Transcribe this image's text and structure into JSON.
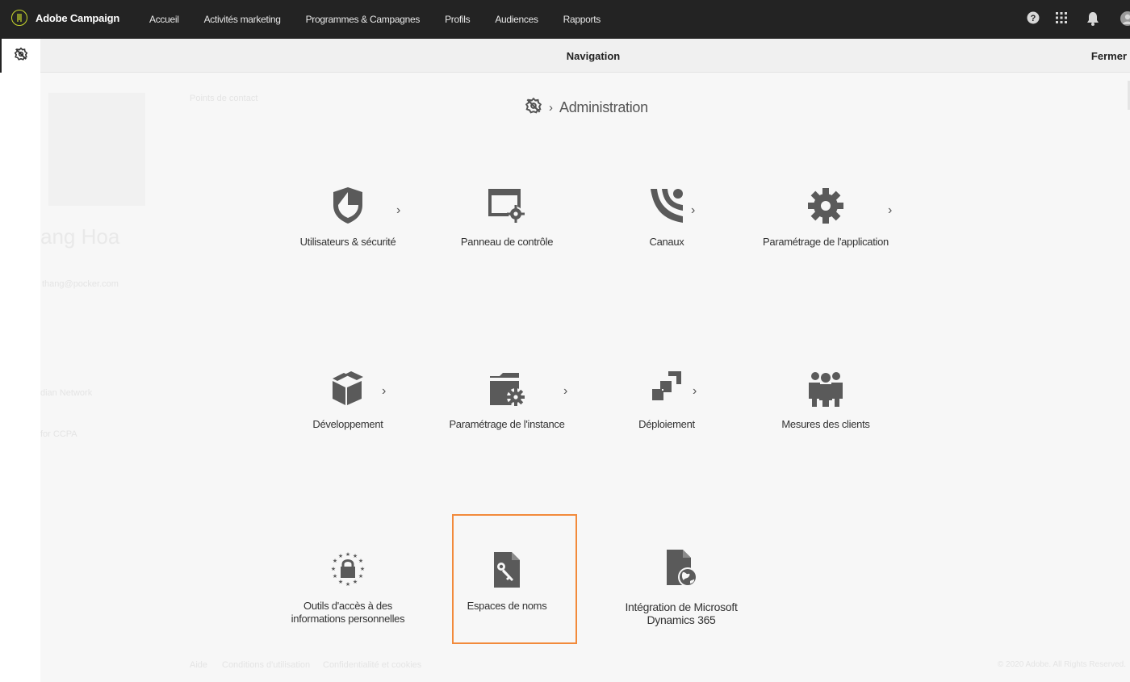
{
  "app": {
    "brand": "Adobe Campaign",
    "colors": {
      "topbar": "#232323",
      "brand_accent": "#c9d82b",
      "highlight": "#f28a3b",
      "icon": "#5a5a5a"
    }
  },
  "topnav": {
    "items": [
      "Accueil",
      "Activités marketing",
      "Programmes & Campagnes",
      "Profils",
      "Audiences",
      "Rapports"
    ],
    "icons": [
      "help-icon",
      "apps-grid-icon",
      "bell-icon",
      "avatar"
    ]
  },
  "navigation": {
    "title": "Navigation",
    "close_label": "Fermer"
  },
  "breadcrumb": {
    "root_icon": "admin-icon",
    "current": "Administration"
  },
  "tiles": [
    {
      "label": "Utilisateurs & sécurité",
      "icon": "shield-icon",
      "has_submenu": true
    },
    {
      "label": "Panneau de contrôle",
      "icon": "control-panel-icon",
      "has_submenu": false
    },
    {
      "label": "Canaux",
      "icon": "channels-icon",
      "has_submenu": true
    },
    {
      "label": "Paramétrage de l'application",
      "icon": "gear-icon",
      "has_submenu": true
    },
    {
      "label": "Développement",
      "icon": "cube-icon",
      "has_submenu": true
    },
    {
      "label": "Paramétrage de l'instance",
      "icon": "instance-settings-icon",
      "has_submenu": true
    },
    {
      "label": "Déploiement",
      "icon": "deployment-icon",
      "has_submenu": true
    },
    {
      "label": "Mesures des clients",
      "icon": "customers-icon",
      "has_submenu": false
    },
    {
      "label": "Outils d'accès à des informations personnelles",
      "label_lines": [
        "Outils d'accès à des",
        "informations personnelles"
      ],
      "icon": "privacy-lock-icon",
      "has_submenu": false
    },
    {
      "label": "Espaces de noms",
      "icon": "namespace-key-icon",
      "has_submenu": false,
      "highlighted": true
    },
    {
      "label": "Intégration de Microsoft Dynamics 365",
      "label_lines": [
        "Intégration de Microsoft",
        "Dynamics 365"
      ],
      "icon": "dynamics-globe-icon",
      "has_submenu": false
    }
  ],
  "background_ghost": {
    "name_fragment": "ang Hoa",
    "contact_label": "Points de contact",
    "email_fragment": "thang@pocker.com",
    "side_item_1": "dian Network",
    "side_item_2": "for CCPA",
    "footer_links": [
      "Aide",
      "Conditions d'utilisation",
      "Confidentialité et cookies"
    ],
    "copyright": "© 2020 Adobe. All Rights Reserved."
  }
}
